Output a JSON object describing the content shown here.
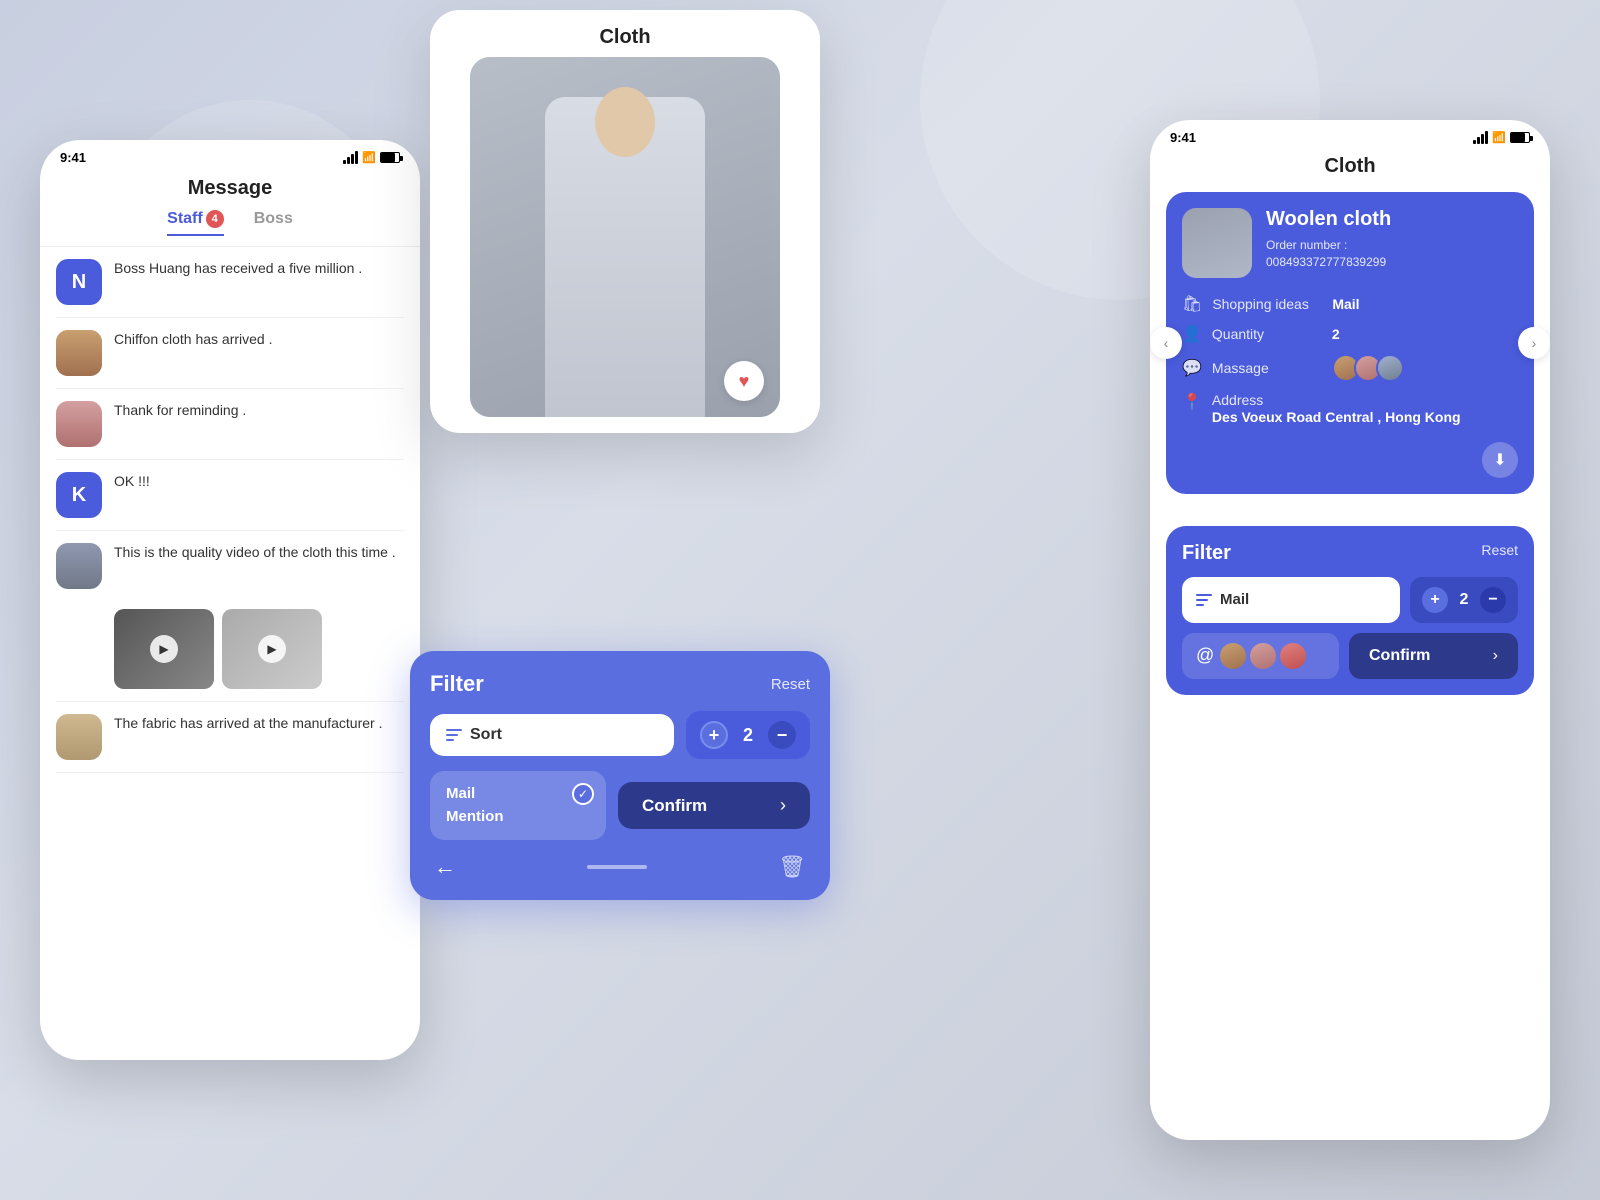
{
  "background": {
    "color": "#c8cfe0"
  },
  "left_phone": {
    "status_bar": {
      "time": "9:41"
    },
    "title": "Message",
    "tabs": [
      {
        "label": "Staff",
        "badge": "4",
        "active": true
      },
      {
        "label": "Boss",
        "active": false
      }
    ],
    "messages": [
      {
        "id": 1,
        "avatar_type": "letter",
        "avatar_letter": "N",
        "text": "Boss Huang has received a five million ."
      },
      {
        "id": 2,
        "avatar_type": "image",
        "text": "Chiffon cloth has arrived ."
      },
      {
        "id": 3,
        "avatar_type": "image",
        "text": "Thank for reminding ."
      },
      {
        "id": 4,
        "avatar_type": "letter",
        "avatar_letter": "K",
        "text": "OK !!!"
      },
      {
        "id": 5,
        "avatar_type": "image",
        "text": "This is the quality video of the cloth this time .",
        "has_videos": true
      },
      {
        "id": 6,
        "avatar_type": "image",
        "text": "The fabric has arrived at the manufacturer ."
      }
    ]
  },
  "mid_card": {
    "title": "Cloth",
    "filter": {
      "title": "Filter",
      "reset_label": "Reset",
      "sort_label": "Sort",
      "counter_value": "2",
      "counter_plus": "+",
      "counter_minus": "−",
      "confirm_label": "Confirm",
      "mail_label": "Mail",
      "mention_label": "Mention"
    }
  },
  "right_phone": {
    "status_bar": {
      "time": "9:41"
    },
    "title": "Cloth",
    "product": {
      "name": "Woolen cloth",
      "order_prefix": "Order number :",
      "order_number": "008493372777839299",
      "shopping_ideas_key": "Shopping ideas",
      "shopping_ideas_val": "Mail",
      "quantity_key": "Quantity",
      "quantity_val": "2",
      "massage_key": "Massage",
      "address_key": "Address",
      "address_val": "Des Voeux Road Central , Hong Kong"
    },
    "filter": {
      "title": "Filter",
      "reset_label": "Reset",
      "mail_label": "Mail",
      "counter_value": "2",
      "confirm_label": "Confirm"
    },
    "nav_arrows": {
      "left": "‹",
      "right": "›"
    }
  }
}
